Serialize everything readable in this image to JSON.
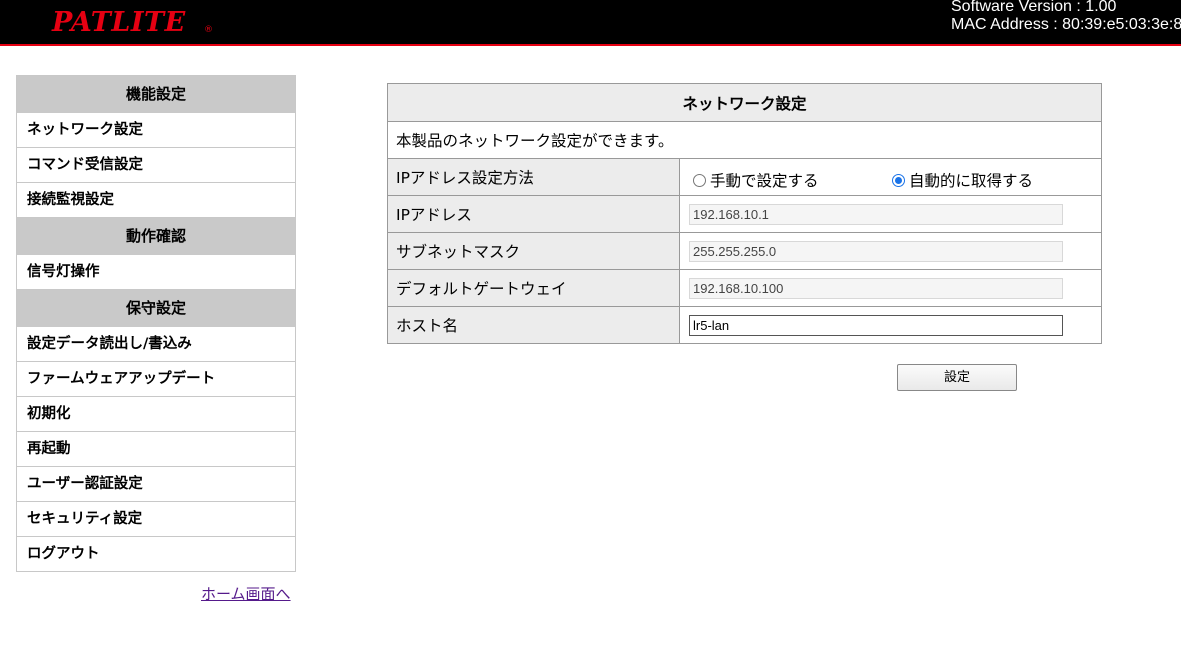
{
  "header": {
    "logo_text": "PATLITE",
    "logo_reg": "®",
    "software_version": "Software Version : 1.00",
    "mac_address": "MAC Address : 80:39:e5:03:3e:8"
  },
  "sidebar": {
    "sections": [
      {
        "title": "機能設定",
        "items": [
          "ネットワーク設定",
          "コマンド受信設定",
          "接続監視設定"
        ]
      },
      {
        "title": "動作確認",
        "items": [
          "信号灯操作"
        ]
      },
      {
        "title": "保守設定",
        "items": [
          "設定データ読出し/書込み",
          "ファームウェアアップデート",
          "初期化",
          "再起動",
          "ユーザー認証設定",
          "セキュリティ設定",
          "ログアウト"
        ]
      }
    ],
    "home_link": "ホーム画面へ"
  },
  "panel": {
    "title": "ネットワーク設定",
    "description": "本製品のネットワーク設定ができます。",
    "ip_method_label": "IPアドレス設定方法",
    "ip_method_manual": "手動で設定する",
    "ip_method_auto": "自動的に取得する",
    "ip_method_selected": "auto",
    "ip_label": "IPアドレス",
    "ip_value": "192.168.10.1",
    "subnet_label": "サブネットマスク",
    "subnet_value": "255.255.255.0",
    "gateway_label": "デフォルトゲートウェイ",
    "gateway_value": "192.168.10.100",
    "host_label": "ホスト名",
    "host_value": "lr5-lan",
    "submit_label": "設定"
  },
  "colors": {
    "brand_red": "#e60012",
    "radio_blue": "#1a73e8",
    "section_gray": "#c9c9c9"
  }
}
